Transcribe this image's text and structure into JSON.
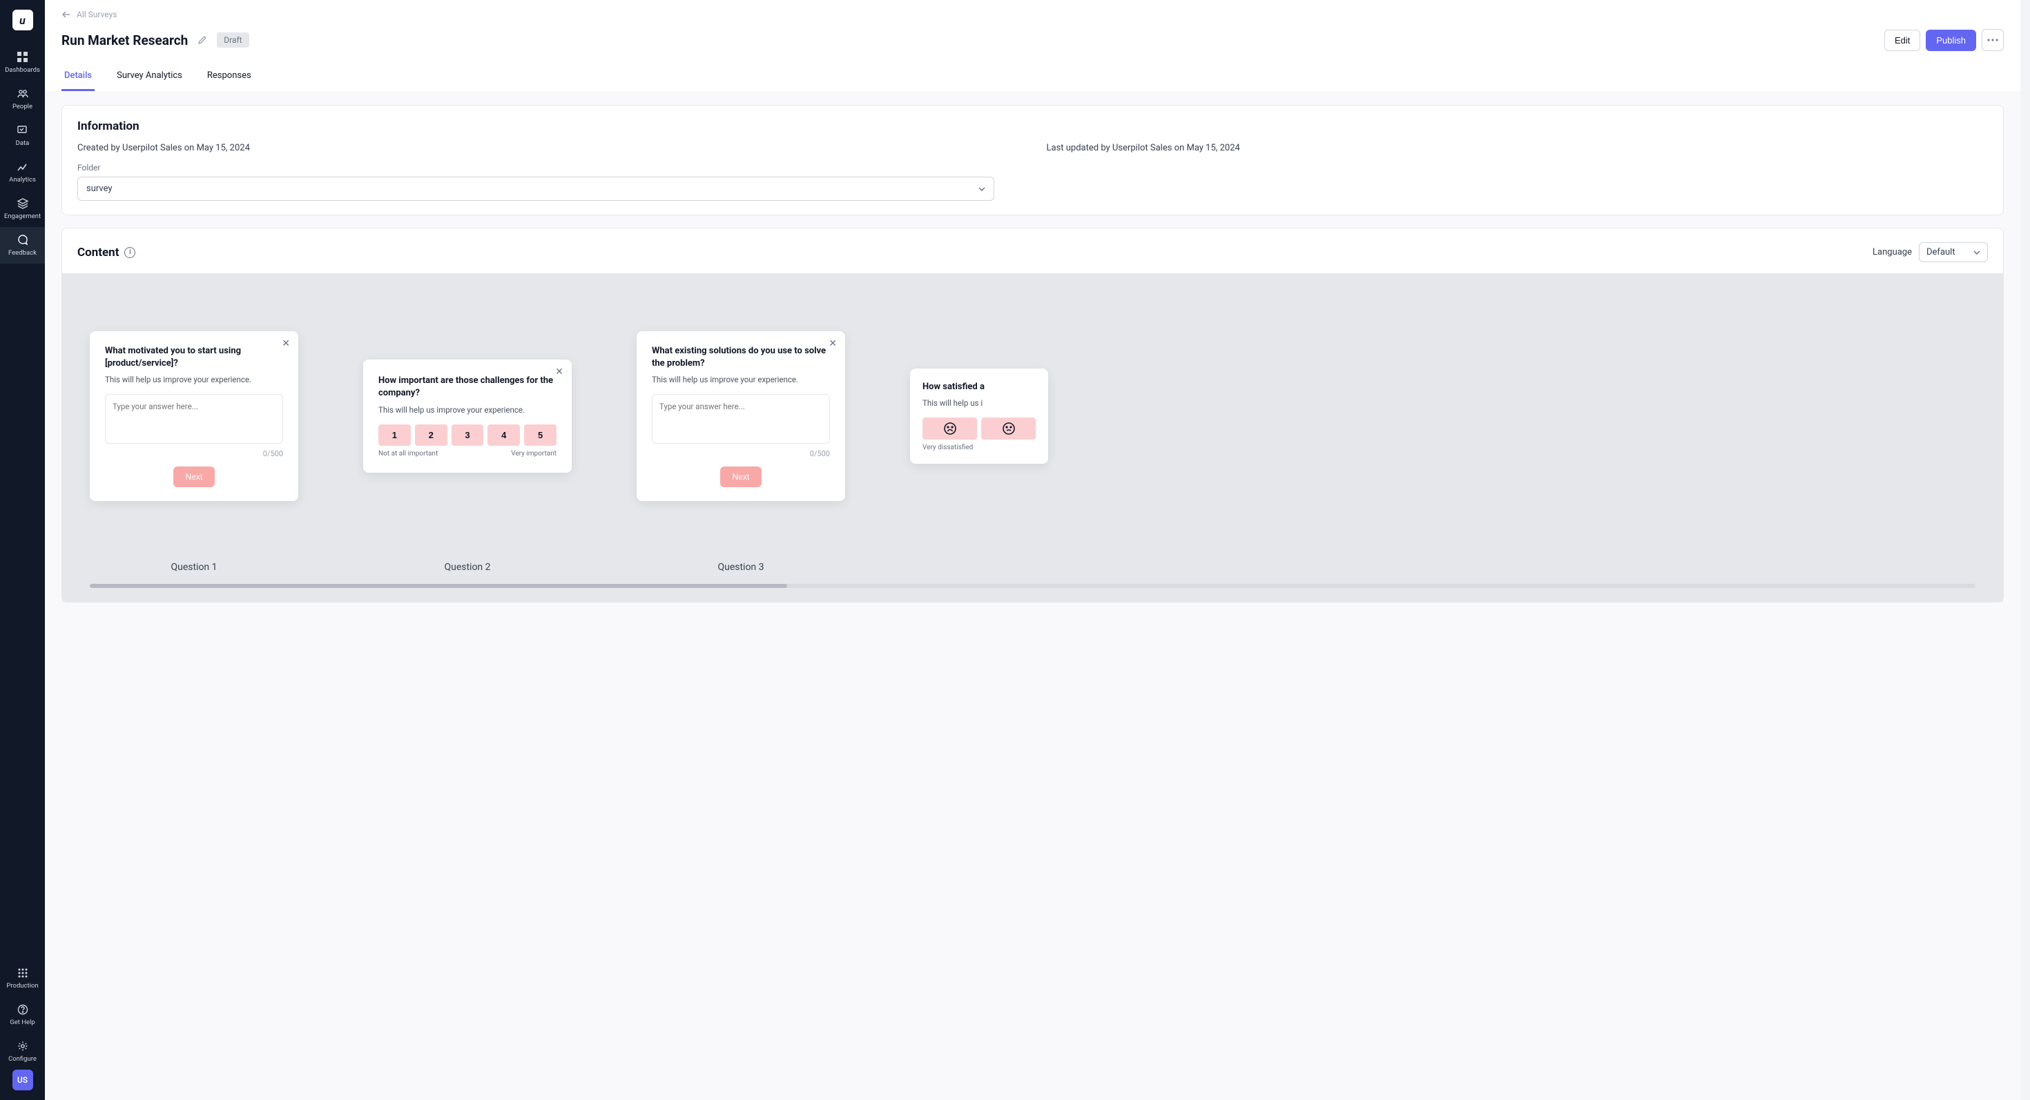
{
  "sidebar": {
    "logo": "u",
    "items": [
      {
        "label": "Dashboards"
      },
      {
        "label": "People"
      },
      {
        "label": "Data"
      },
      {
        "label": "Analytics"
      },
      {
        "label": "Engagement"
      },
      {
        "label": "Feedback"
      }
    ],
    "bottom": [
      {
        "label": "Production"
      },
      {
        "label": "Get Help"
      },
      {
        "label": "Configure"
      }
    ],
    "avatar": "US"
  },
  "breadcrumb": "All Surveys",
  "title": "Run Market Research",
  "status": "Draft",
  "actions": {
    "edit": "Edit",
    "publish": "Publish"
  },
  "tabs": [
    "Details",
    "Survey Analytics",
    "Responses"
  ],
  "info": {
    "heading": "Information",
    "created": "Created by Userpilot Sales on May 15, 2024",
    "updated": "Last updated by Userpilot Sales on May 15, 2024",
    "folder_label": "Folder",
    "folder_value": "survey"
  },
  "content": {
    "heading": "Content",
    "language_label": "Language",
    "language_value": "Default"
  },
  "questions": [
    {
      "title": "What motivated you to start using [product/service]?",
      "subtitle": "This will help us improve your experience.",
      "placeholder": "Type your answer here...",
      "counter": "0/500",
      "next": "Next",
      "label": "Question 1"
    },
    {
      "title": "How important are those challenges for the company?",
      "subtitle": "This will help us improve your experience.",
      "options": [
        "1",
        "2",
        "3",
        "4",
        "5"
      ],
      "low": "Not at all important",
      "high": "Very important",
      "label": "Question 2"
    },
    {
      "title": "What existing solutions do you use to solve the problem?",
      "subtitle": "This will help us improve your experience.",
      "placeholder": "Type your answer here...",
      "counter": "0/500",
      "next": "Next",
      "label": "Question 3"
    },
    {
      "title": "How satisfied a",
      "subtitle": "This will help us i",
      "low": "Very dissatisfied"
    }
  ]
}
